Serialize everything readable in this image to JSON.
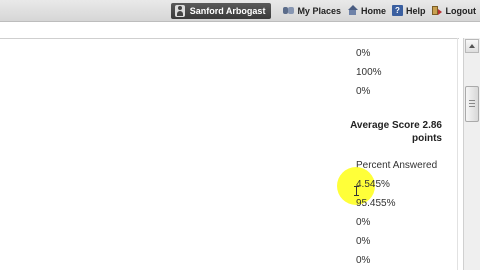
{
  "topbar": {
    "user_name": "Sanford Arbogast",
    "nav": [
      {
        "label": "My Places",
        "icon": "places-icon"
      },
      {
        "label": "Home",
        "icon": "home-icon"
      },
      {
        "label": "Help",
        "icon": "help-icon",
        "glyph": "?"
      },
      {
        "label": "Logout",
        "icon": "logout-icon"
      }
    ]
  },
  "results": {
    "top_values": [
      "0%",
      "100%",
      "0%"
    ],
    "average_line1": "Average Score 2.86",
    "average_line2": "points",
    "percent_answered_label": "Percent Answered",
    "percent_values": [
      "4.545%",
      "95.455%",
      "0%",
      "0%",
      "0%"
    ]
  }
}
